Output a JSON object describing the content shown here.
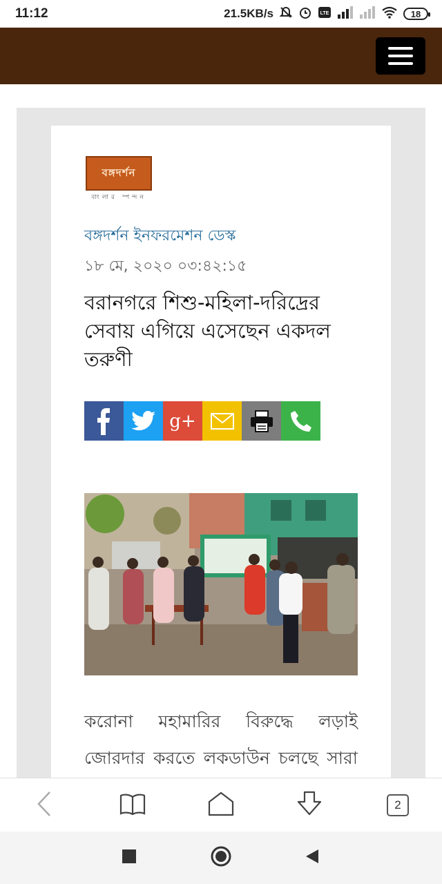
{
  "status": {
    "time": "11:12",
    "speed": "21.5KB/s",
    "battery": "18"
  },
  "article": {
    "logo_text": "বঙ্গদর্শন",
    "logo_sub": "বাংলার স্পন্দন",
    "author": "বঙ্গদর্শন ইনফরমেশন ডেস্ক",
    "date": "১৮ মে, ২০২০ ০৩:৪২:১৫",
    "headline": "বরানগরে শিশু-মহিলা-দরিদ্রের সেবায় এগিয়ে এসেছেন একদল তরুণী",
    "paragraph": "করোনা মহামারির বিরুদ্ধে লড়াই জোরদার করতে লকডাউন চলছে সারা"
  },
  "share": {
    "google_label": "g+"
  },
  "browser": {
    "tab_count": "2"
  },
  "colors": {
    "header_brown": "#4a260c",
    "facebook": "#3b5998",
    "twitter": "#1da1f2",
    "google": "#dd4b39",
    "email": "#f2c200",
    "print": "#7d7d7d",
    "call": "#3cb349",
    "author_blue": "#2b6f9c"
  },
  "icons": {
    "share": [
      "facebook-icon",
      "twitter-icon",
      "google-plus-icon",
      "email-icon",
      "print-icon",
      "phone-icon"
    ],
    "browser": [
      "back-icon",
      "bookmarks-icon",
      "home-icon",
      "download-icon",
      "tabs-icon"
    ],
    "nav": [
      "recents-icon",
      "home-circle-icon",
      "back-triangle-icon"
    ]
  }
}
